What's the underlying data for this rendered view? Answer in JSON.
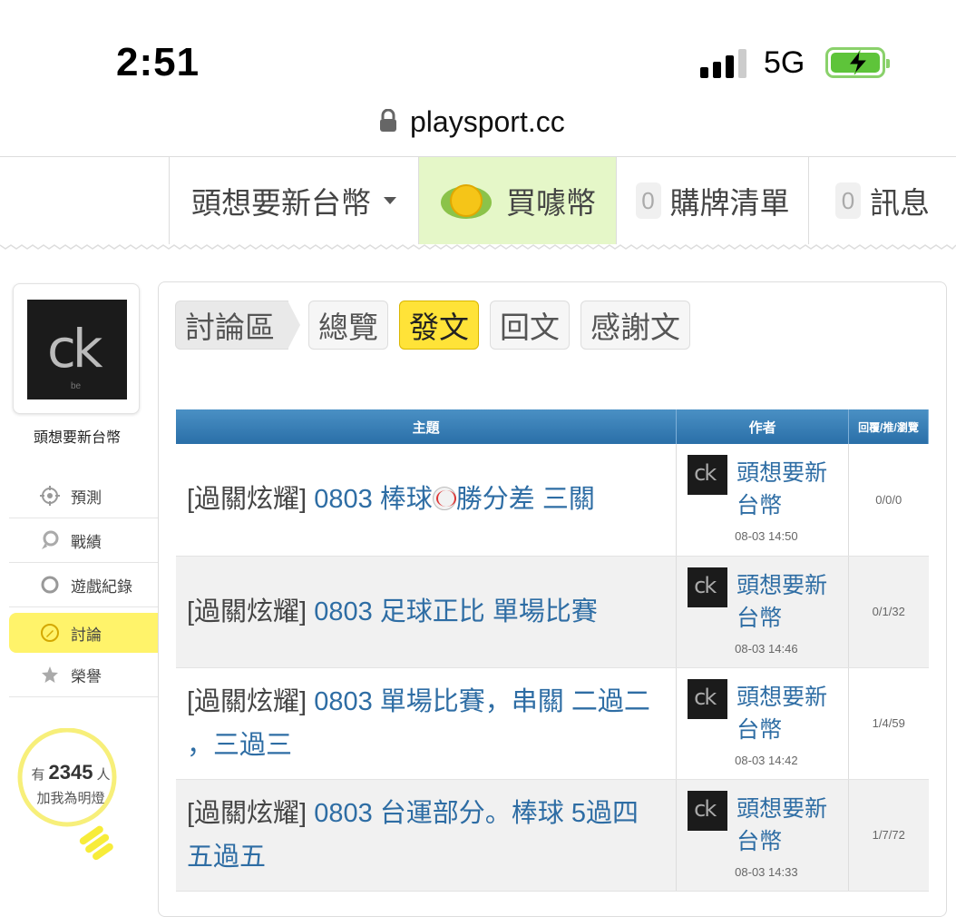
{
  "status": {
    "time": "2:51",
    "network": "5G"
  },
  "browser": {
    "url": "playsport.cc"
  },
  "topnav": {
    "user": "頭想要新台幣",
    "buy": "買噱幣",
    "buy_coin_text": "噱",
    "cart_count": "0",
    "cart": "購牌清單",
    "msg_count": "0",
    "msg": "訊息"
  },
  "sidebar": {
    "avatar_text": "ck",
    "avatar_sub": "be",
    "name": "頭想要新台幣",
    "items": [
      {
        "label": "預測",
        "icon": "target-icon"
      },
      {
        "label": "戰績",
        "icon": "medal-icon"
      },
      {
        "label": "遊戲紀錄",
        "icon": "circle-icon"
      },
      {
        "label": "討論",
        "icon": "edit-icon"
      },
      {
        "label": "榮譽",
        "icon": "star-icon"
      }
    ],
    "bulb_prefix": "有",
    "bulb_count": "2345",
    "bulb_suffix": "人",
    "bulb_action": "加我為明燈"
  },
  "tabs": {
    "crumb": "討論區",
    "overview": "總覽",
    "post": "發文",
    "reply": "回文",
    "thanks": "感謝文"
  },
  "table": {
    "headers": {
      "topic": "主題",
      "author": "作者",
      "stats": "回覆/推/瀏覽"
    },
    "rows": [
      {
        "tag": "[過關炫耀]",
        "title_a": "0803 棒球",
        "title_b": "勝分差 三關",
        "author": "頭想要新台幣",
        "time": "08-03 14:50",
        "stats": "0/0/0"
      },
      {
        "tag": "[過關炫耀]",
        "title": "0803 足球正比 單場比賽",
        "author": "頭想要新台幣",
        "time": "08-03 14:46",
        "stats": "0/1/32"
      },
      {
        "tag": "[過關炫耀]",
        "title": "0803 單場比賽，串關 二過二 ，三過三",
        "author": "頭想要新台幣",
        "time": "08-03 14:42",
        "stats": "1/4/59"
      },
      {
        "tag": "[過關炫耀]",
        "title": "0803 台運部分。棒球 5過四 五過五",
        "author": "頭想要新台幣",
        "time": "08-03 14:33",
        "stats": "1/7/72"
      }
    ]
  }
}
